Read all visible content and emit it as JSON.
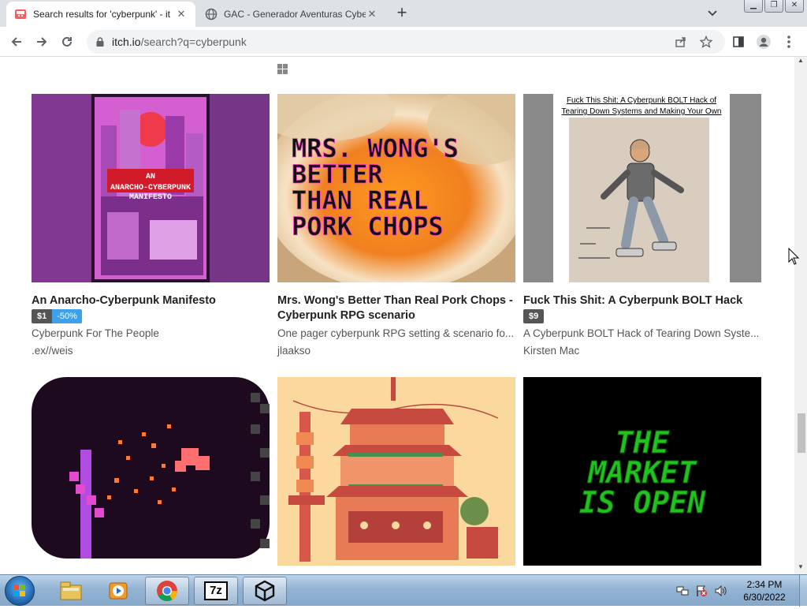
{
  "browser": {
    "tabs": [
      {
        "title": "Search results for 'cyberpunk' - it",
        "active": true
      },
      {
        "title": "GAC - Generador Aventuras Cybe",
        "active": false
      }
    ],
    "address": {
      "host": "itch.io",
      "path": "/search?q=cyberpunk"
    }
  },
  "games": [
    {
      "title": "An Anarcho-Cyberpunk Manifesto",
      "price": "$1",
      "discount": "-50%",
      "description": "Cyberpunk For The People",
      "author": ".ex//weis",
      "cover_text": "AN ANARCHO-CYBERPUNK MANIFESTO"
    },
    {
      "title": "Mrs. Wong's Better Than Real Pork Chops - Cyberpunk RPG scenario",
      "price": "",
      "discount": "",
      "description": "One pager cyberpunk RPG setting & scenario fo...",
      "author": "jlaakso",
      "cover_text": [
        "MRS. WONG'S",
        "BETTER",
        "THAN REAL",
        "PORK CHOPS"
      ]
    },
    {
      "title": "Fuck This Shit: A Cyberpunk BOLT Hack",
      "price": "$9",
      "discount": "",
      "description": "A Cyberpunk BOLT Hack of Tearing Down Syste...",
      "author": "Kirsten Mac",
      "cover_text": [
        "Fuck This Shit: A Cyberpunk BOLT Hack of",
        "Tearing Down Systems and Making Your Own"
      ]
    },
    {
      "title": "",
      "price": "",
      "discount": "",
      "description": "",
      "author": "",
      "cover_text": ""
    },
    {
      "title": "",
      "price": "",
      "discount": "",
      "description": "",
      "author": "",
      "cover_text": ""
    },
    {
      "title": "",
      "price": "",
      "discount": "",
      "description": "",
      "author": "",
      "cover_text": [
        "THE",
        "MARKET",
        "IS OPEN"
      ]
    }
  ],
  "taskbar": {
    "items": [
      "explorer-icon",
      "media-player-icon",
      "chrome-icon",
      "7zip-icon",
      "unity-icon"
    ],
    "seven_zip_label": "7z",
    "clock_time": "2:34 PM",
    "clock_date": "6/30/2022"
  },
  "colors": {
    "discount": "#3da0e8",
    "price": "#555555",
    "tabstrip": "#dee1e6"
  }
}
